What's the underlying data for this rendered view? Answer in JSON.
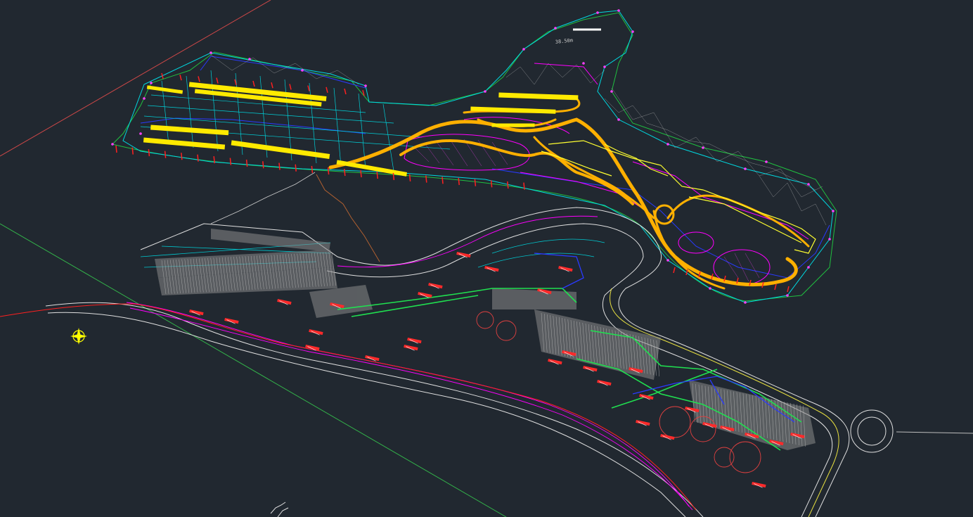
{
  "drawing": {
    "background": "#212830",
    "scale_label": "38.50m",
    "north_symbol": "compass-rose",
    "layer_colors": {
      "road_edge": "#ffc000",
      "grid_cyan": "#00d8e0",
      "boundary_blue": "#1f2cff",
      "magenta": "#ff00ff",
      "red_markers": "#ff2020",
      "green": "#20d040",
      "yellow": "#ffff00",
      "white": "#e8e8e8",
      "gray_hatch": "#9a9a9a"
    }
  }
}
